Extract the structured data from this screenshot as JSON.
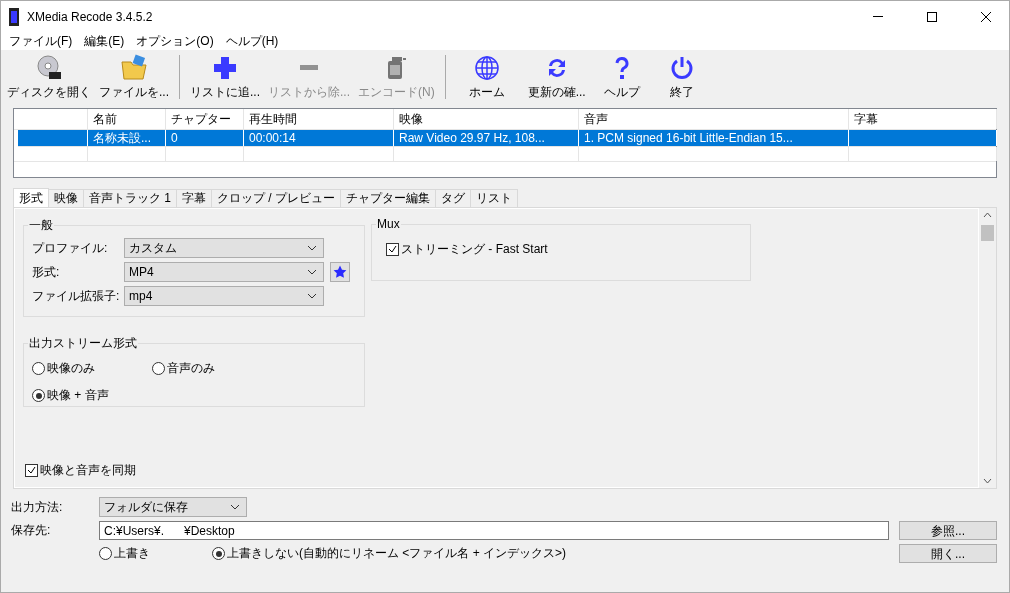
{
  "window": {
    "title": "XMedia Recode 3.4.5.2"
  },
  "menu": [
    "ファイル(F)",
    "編集(E)",
    "オプション(O)",
    "ヘルプ(H)"
  ],
  "toolbar": [
    [
      {
        "label": "ディスクを開く",
        "disabled": false
      },
      {
        "label": "ファイルを...",
        "disabled": false
      }
    ],
    [
      {
        "label": "リストに追...",
        "disabled": false
      },
      {
        "label": "リストから除...",
        "disabled": true
      },
      {
        "label": "エンコード(N)",
        "disabled": true
      }
    ],
    [
      {
        "label": "ホーム",
        "disabled": false
      },
      {
        "label": "更新の確...",
        "disabled": false
      },
      {
        "label": "ヘルプ",
        "disabled": false
      },
      {
        "label": "終了",
        "disabled": false
      }
    ]
  ],
  "table": {
    "columns": [
      "名前",
      "チャプター",
      "再生時間",
      "映像",
      "音声",
      "字幕"
    ],
    "rows": [
      {
        "selected": true,
        "cells": [
          "名称未設...",
          "0",
          "00:00:14",
          "Raw Video 29.97 Hz, 108...",
          "1. PCM signed 16-bit Little-Endian 15..."
        ]
      }
    ]
  },
  "tabs": [
    {
      "label": "形式",
      "selected": true
    },
    {
      "label": "映像",
      "selected": false
    },
    {
      "label": "音声トラック 1",
      "selected": false
    },
    {
      "label": "字幕",
      "selected": false
    },
    {
      "label": "クロップ / プレビュー",
      "selected": false
    },
    {
      "label": "チャプター編集",
      "selected": false
    },
    {
      "label": "タグ",
      "selected": false
    },
    {
      "label": "リスト",
      "selected": false
    }
  ],
  "general": {
    "title": "一般",
    "fields": [
      {
        "label": "プロファイル:",
        "value": "カスタム",
        "favorite": false
      },
      {
        "label": "形式:",
        "value": "MP4",
        "favorite": true
      },
      {
        "label": "ファイル拡張子:",
        "value": "mp4",
        "favorite": false
      }
    ]
  },
  "mux": {
    "title": "Mux",
    "options": [
      {
        "label": "ストリーミング - Fast Start",
        "checked": true
      }
    ]
  },
  "output_streams": {
    "title": "出力ストリーム形式",
    "options": [
      {
        "label": "映像のみ",
        "selected": false
      },
      {
        "label": "音声のみ",
        "selected": false
      },
      {
        "label": "映像 + 音声",
        "selected": true
      }
    ]
  },
  "sync": {
    "label": "映像と音声を同期",
    "checked": true
  },
  "output": {
    "method_label": "出力方法:",
    "method": "フォルダに保存",
    "dest_label": "保存先:",
    "path": "C:¥Users¥.      ¥Desktop",
    "browse": "参照...",
    "open": "開く...",
    "overwrite": [
      {
        "label": "上書き",
        "selected": false
      },
      {
        "label": "上書きしない(自動的にリネーム <ファイル名 + インデックス>)",
        "selected": true
      }
    ]
  }
}
